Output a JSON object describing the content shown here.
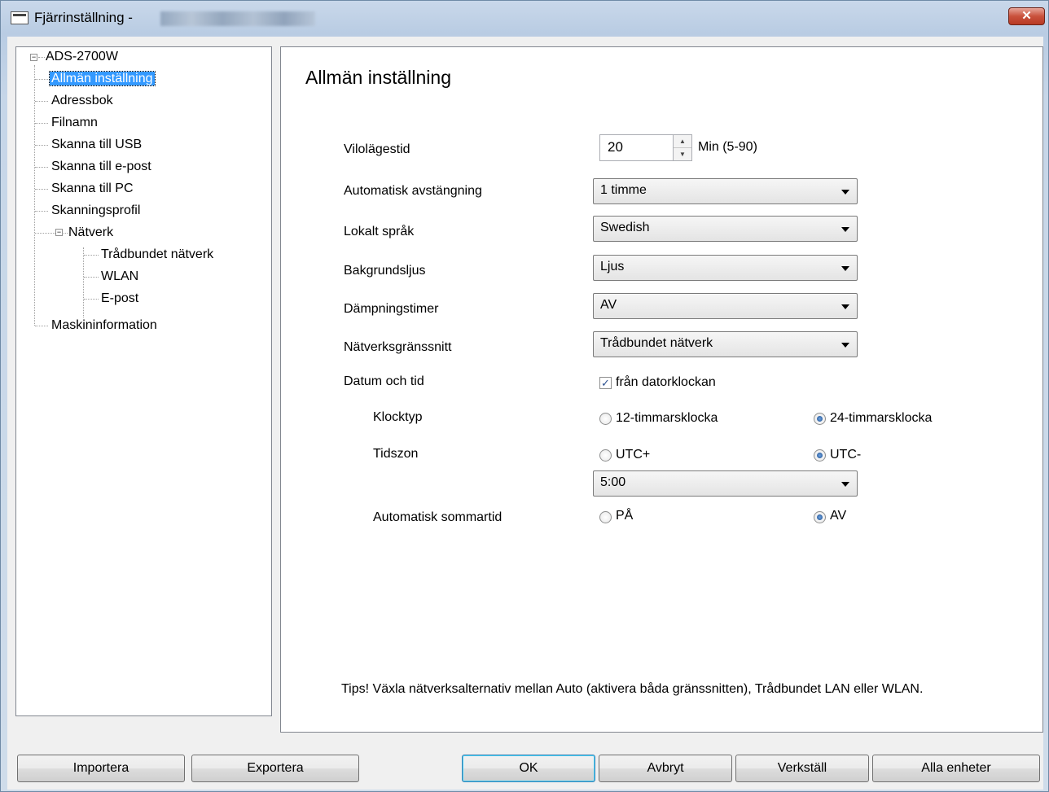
{
  "window": {
    "title": "Fjärrinställning -",
    "close_label": "✕"
  },
  "tree": {
    "root": "ADS-2700W",
    "items": [
      {
        "label": "Allmän inställning",
        "selected": true
      },
      {
        "label": "Adressbok"
      },
      {
        "label": "Filnamn"
      },
      {
        "label": "Skanna till USB"
      },
      {
        "label": "Skanna till e-post"
      },
      {
        "label": "Skanna till PC"
      },
      {
        "label": "Skanningsprofil"
      },
      {
        "label": "Nätverk",
        "expanded": true
      },
      {
        "label": "Trådbundet nätverk"
      },
      {
        "label": "WLAN"
      },
      {
        "label": "E-post"
      },
      {
        "label": "Maskininformation"
      }
    ]
  },
  "panel": {
    "title": "Allmän inställning",
    "sleep_time": {
      "label": "Vilolägestid",
      "value": "20",
      "unit": "Min (5-90)"
    },
    "auto_power_off": {
      "label": "Automatisk avstängning",
      "value": "1 timme"
    },
    "local_language": {
      "label": "Lokalt språk",
      "value": "Swedish"
    },
    "backlight": {
      "label": "Bakgrundsljus",
      "value": "Ljus"
    },
    "dim_timer": {
      "label": "Dämpningstimer",
      "value": "AV"
    },
    "network_interface": {
      "label": "Nätverksgränssnitt",
      "value": "Trådbundet nätverk"
    },
    "date_time": {
      "label": "Datum och tid",
      "checkbox_label": "från datorklockan",
      "checked": true
    },
    "clock_type": {
      "label": "Klocktyp",
      "option1": "12-timmarsklocka",
      "option2": "24-timmarsklocka",
      "selected": "24-timmarsklocka"
    },
    "time_zone": {
      "label": "Tidszon",
      "option1": "UTC+",
      "option2": "UTC-",
      "selected": "UTC-",
      "value": "5:00"
    },
    "dst": {
      "label": "Automatisk sommartid",
      "option1": "PÅ",
      "option2": "AV",
      "selected": "AV"
    },
    "tips": "Tips! Växla nätverksalternativ mellan Auto (aktivera båda gränssnitten), Trådbundet LAN eller WLAN."
  },
  "buttons": {
    "import": "Importera",
    "export": "Exportera",
    "ok": "OK",
    "cancel": "Avbryt",
    "apply": "Verkställ",
    "all_devices": "Alla enheter"
  }
}
